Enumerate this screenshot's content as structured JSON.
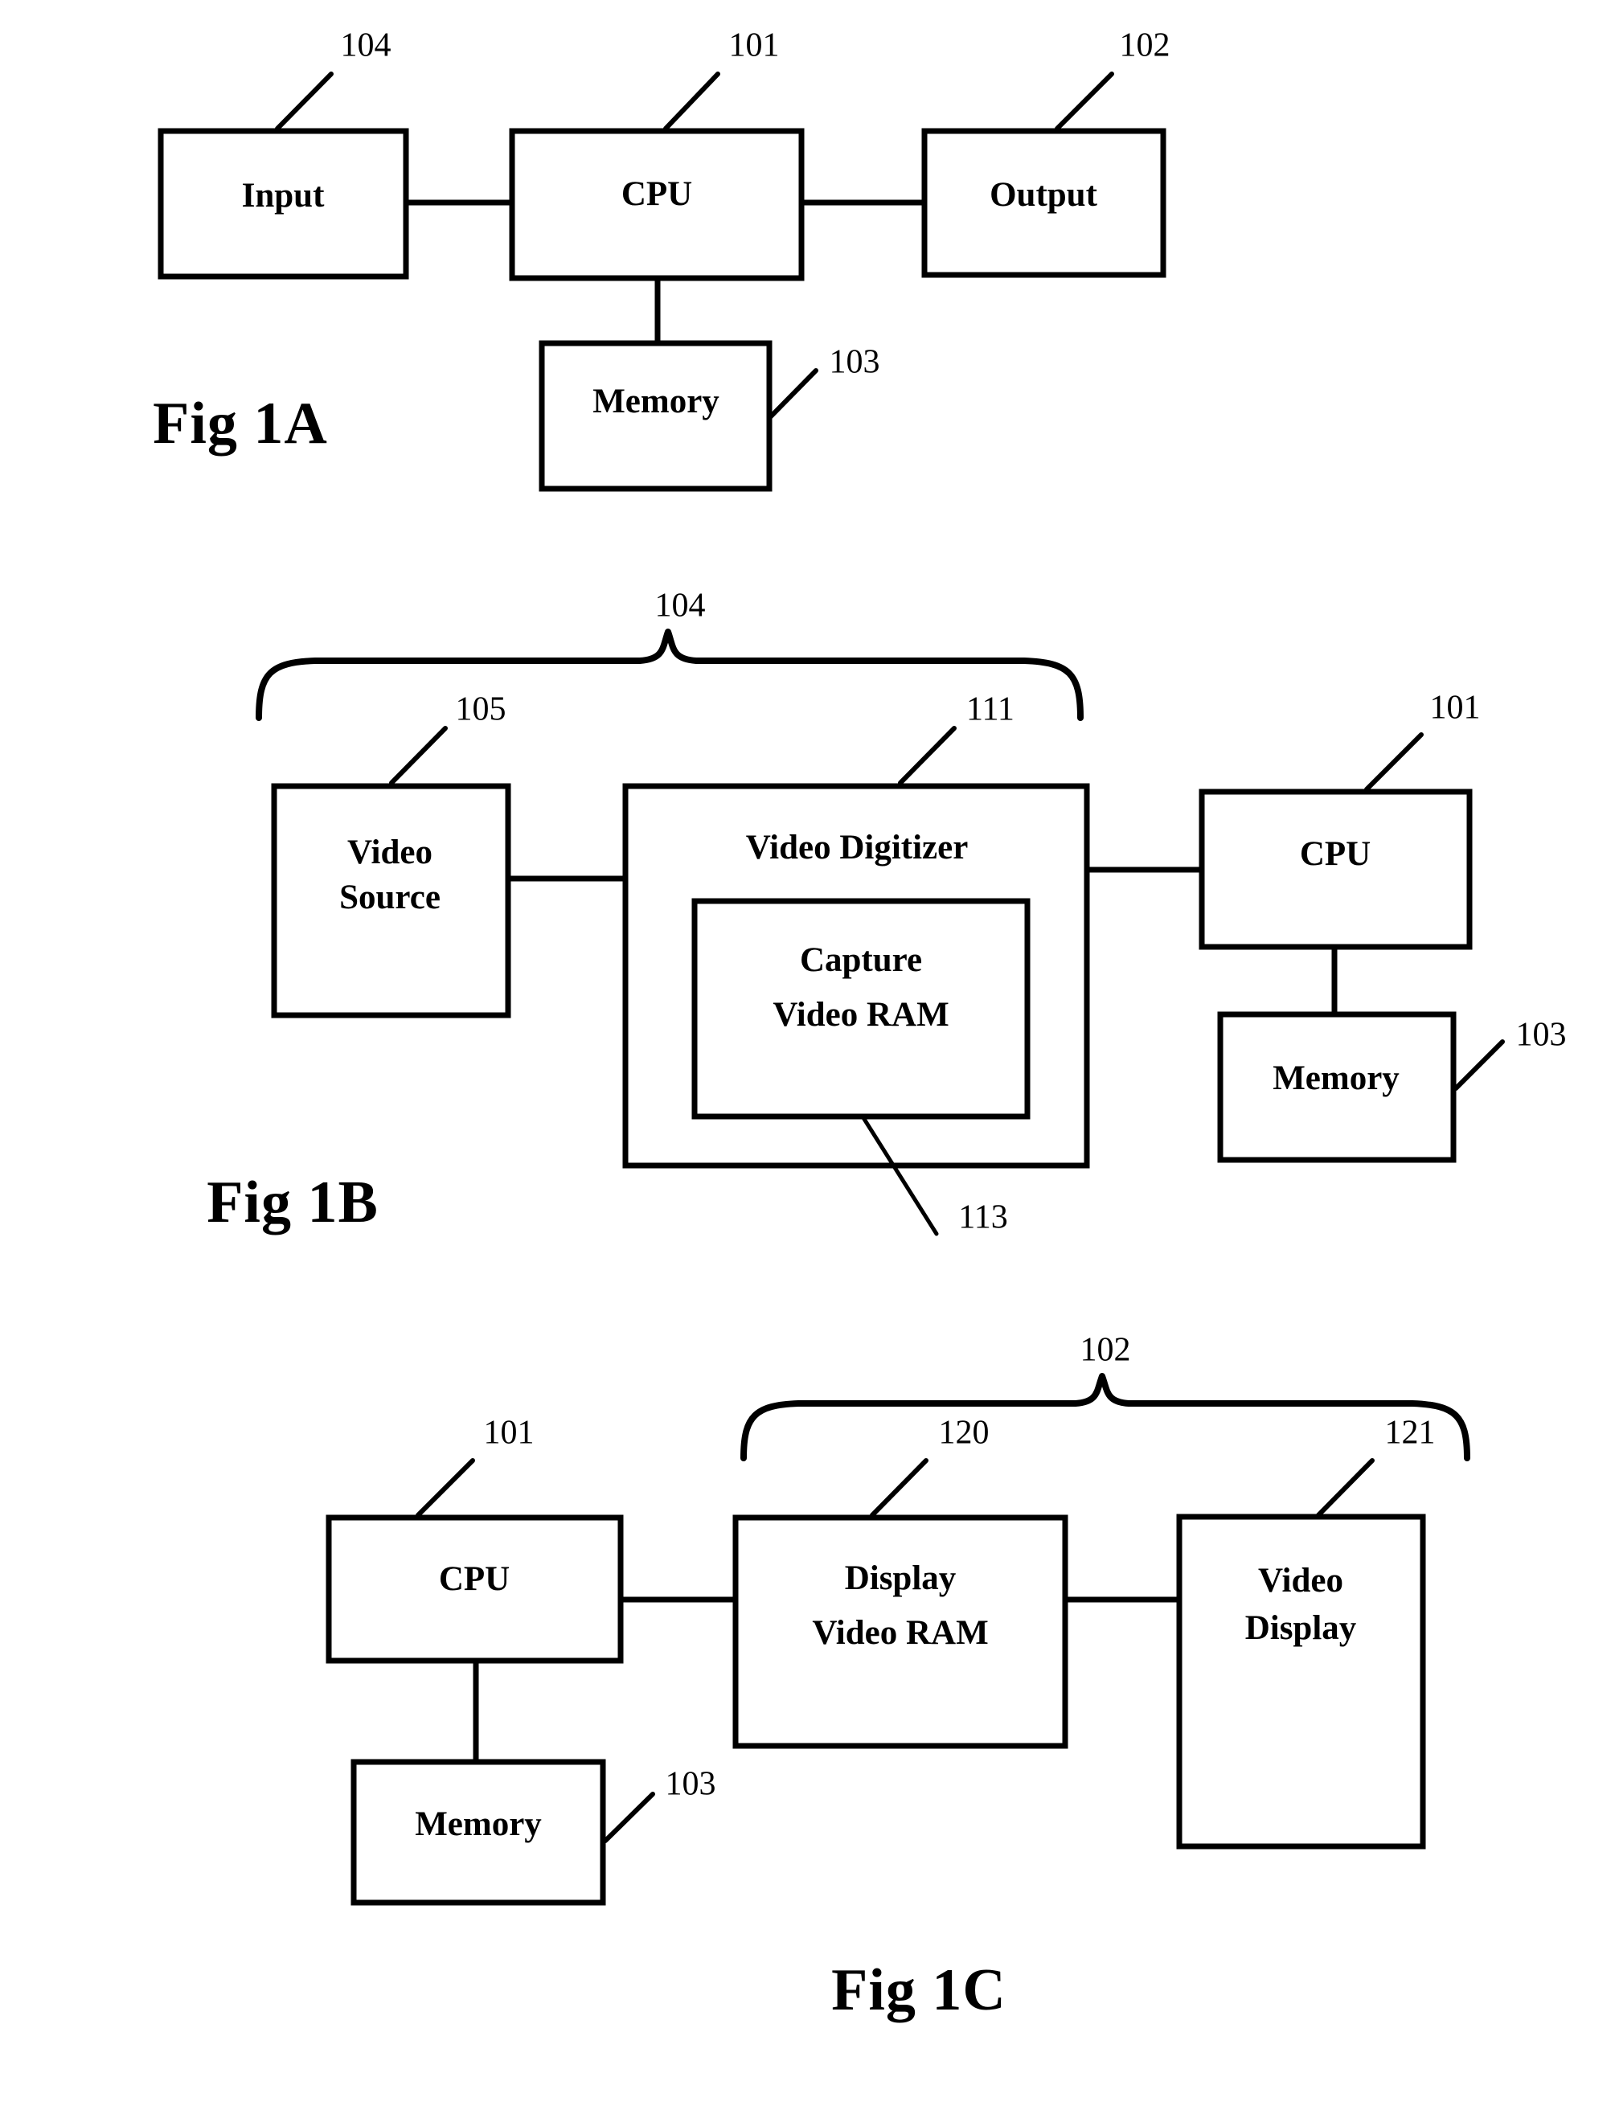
{
  "document": {
    "kind": "patent-figure-sheet",
    "figures": [
      {
        "id": "fig-1a",
        "caption": "Fig 1A",
        "boxes": [
          {
            "id": "input",
            "label": "Input"
          },
          {
            "id": "cpu",
            "label": "CPU"
          },
          {
            "id": "output",
            "label": "Output"
          },
          {
            "id": "memory",
            "label": "Memory"
          }
        ],
        "reference_numerals": [
          {
            "id": "ref-104",
            "value": "104",
            "points_to": "input"
          },
          {
            "id": "ref-101",
            "value": "101",
            "points_to": "cpu"
          },
          {
            "id": "ref-102",
            "value": "102",
            "points_to": "output"
          },
          {
            "id": "ref-103",
            "value": "103",
            "points_to": "memory"
          }
        ],
        "connections": [
          {
            "from": "input",
            "to": "cpu"
          },
          {
            "from": "cpu",
            "to": "output"
          },
          {
            "from": "cpu",
            "to": "memory"
          }
        ]
      },
      {
        "id": "fig-1b",
        "caption": "Fig 1B",
        "boxes": [
          {
            "id": "video-source",
            "label_line1": "Video",
            "label_line2": "Source"
          },
          {
            "id": "video-digitizer",
            "label": "Video Digitizer"
          },
          {
            "id": "capture-video-ram",
            "label_line1": "Capture",
            "label_line2": "Video RAM"
          },
          {
            "id": "cpu",
            "label": "CPU"
          },
          {
            "id": "memory",
            "label": "Memory"
          }
        ],
        "reference_numerals": [
          {
            "id": "ref-104",
            "value": "104",
            "points_to": "input-subsystem-brace"
          },
          {
            "id": "ref-105",
            "value": "105",
            "points_to": "video-source"
          },
          {
            "id": "ref-111",
            "value": "111",
            "points_to": "video-digitizer"
          },
          {
            "id": "ref-101",
            "value": "101",
            "points_to": "cpu"
          },
          {
            "id": "ref-103",
            "value": "103",
            "points_to": "memory"
          },
          {
            "id": "ref-113",
            "value": "113",
            "points_to": "capture-video-ram"
          }
        ],
        "connections": [
          {
            "from": "video-source",
            "to": "video-digitizer"
          },
          {
            "from": "video-digitizer",
            "to": "cpu"
          },
          {
            "from": "cpu",
            "to": "memory"
          }
        ],
        "brace": {
          "id": "input-subsystem-brace",
          "groups": [
            "video-source",
            "video-digitizer"
          ]
        }
      },
      {
        "id": "fig-1c",
        "caption": "Fig 1C",
        "boxes": [
          {
            "id": "cpu",
            "label": "CPU"
          },
          {
            "id": "display-video-ram",
            "label_line1": "Display",
            "label_line2": "Video RAM"
          },
          {
            "id": "video-display",
            "label_line1": "Video",
            "label_line2": "Display"
          },
          {
            "id": "memory",
            "label": "Memory"
          }
        ],
        "reference_numerals": [
          {
            "id": "ref-102",
            "value": "102",
            "points_to": "output-subsystem-brace"
          },
          {
            "id": "ref-101",
            "value": "101",
            "points_to": "cpu"
          },
          {
            "id": "ref-120",
            "value": "120",
            "points_to": "display-video-ram"
          },
          {
            "id": "ref-121",
            "value": "121",
            "points_to": "video-display"
          },
          {
            "id": "ref-103",
            "value": "103",
            "points_to": "memory"
          }
        ],
        "connections": [
          {
            "from": "cpu",
            "to": "display-video-ram"
          },
          {
            "from": "display-video-ram",
            "to": "video-display"
          },
          {
            "from": "cpu",
            "to": "memory"
          }
        ],
        "brace": {
          "id": "output-subsystem-brace",
          "groups": [
            "display-video-ram",
            "video-display"
          ]
        }
      }
    ],
    "colors": {
      "ink": "#000000",
      "paper": "#ffffff"
    }
  }
}
